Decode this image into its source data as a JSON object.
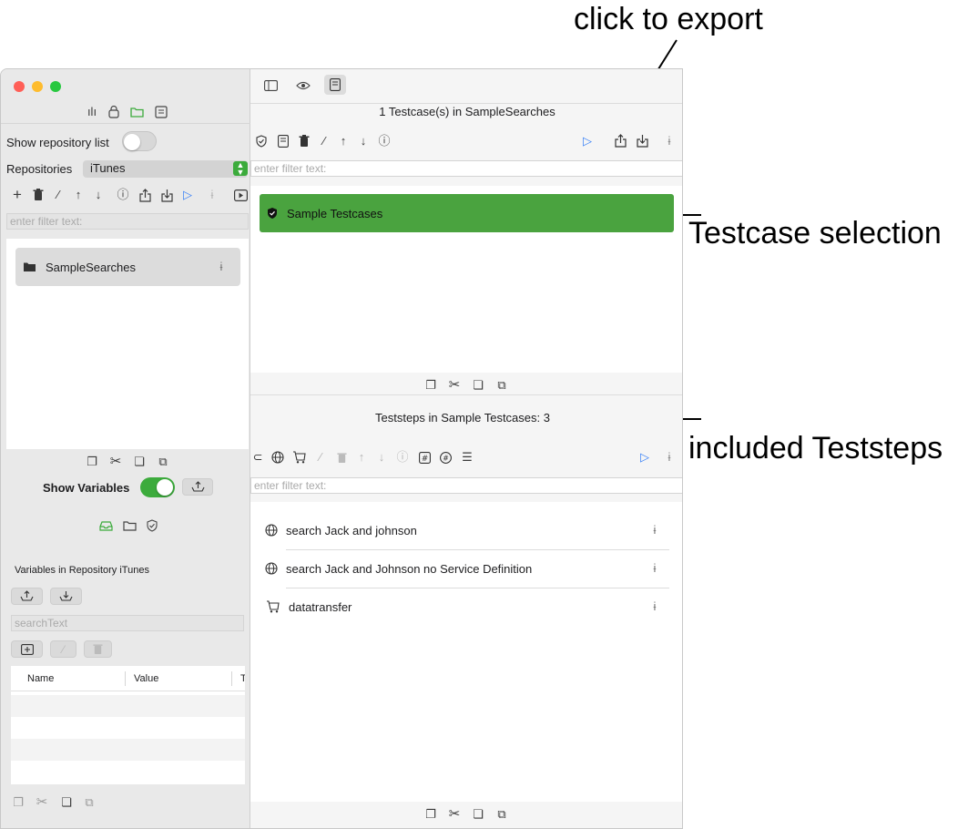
{
  "annotations": {
    "export": "click to export",
    "testcase_selection": "Testcase selection",
    "included_teststeps": "included Teststeps"
  },
  "left": {
    "show_repository_list": "Show repository list",
    "repositories_label": "Repositories",
    "repository_selected": "iTunes",
    "filter_placeholder": "enter filter text:",
    "repo_item": "SampleSearches",
    "show_variables": "Show Variables",
    "variables_header": "Variables in  Repository iTunes",
    "search_placeholder": "searchText",
    "table_headers": [
      "Name",
      "Value",
      "T"
    ]
  },
  "right": {
    "testcases_header": "1 Testcase(s) in SampleSearches",
    "filter_placeholder": "enter filter text:",
    "testcase_item": "Sample Testcases",
    "teststeps_header": "Teststeps in Sample Testcases: 3",
    "teststeps": [
      {
        "label": "search Jack and johnson",
        "icon": "globe-icon"
      },
      {
        "label": "search Jack and Johnson no Service Definition",
        "icon": "globe-icon"
      },
      {
        "label": "datatransfer",
        "icon": "cart-icon"
      }
    ]
  },
  "colors": {
    "accent_green": "#4aa33f",
    "toggle_green": "#34c759",
    "red_light": "#ff5f57",
    "yellow_light": "#febc2e",
    "green_light": "#28c840",
    "blue": "#3b82f6"
  }
}
